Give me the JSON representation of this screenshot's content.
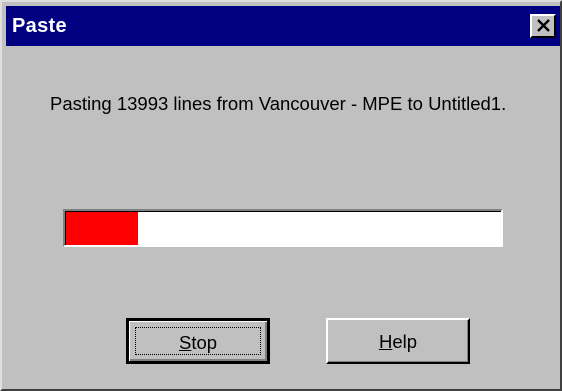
{
  "window": {
    "title": "Paste",
    "message": "Pasting 13993 lines from Vancouver - MPE to Untitled1.",
    "title_bar_color": "#000080",
    "background_color": "#c0c0c0"
  },
  "progress": {
    "fraction": 0.165,
    "fill_color": "#ff0000"
  },
  "buttons": {
    "stop": {
      "mnemonic": "S",
      "rest": "top"
    },
    "help": {
      "mnemonic": "H",
      "rest": "elp"
    }
  },
  "icons": {
    "close": "close-icon"
  }
}
